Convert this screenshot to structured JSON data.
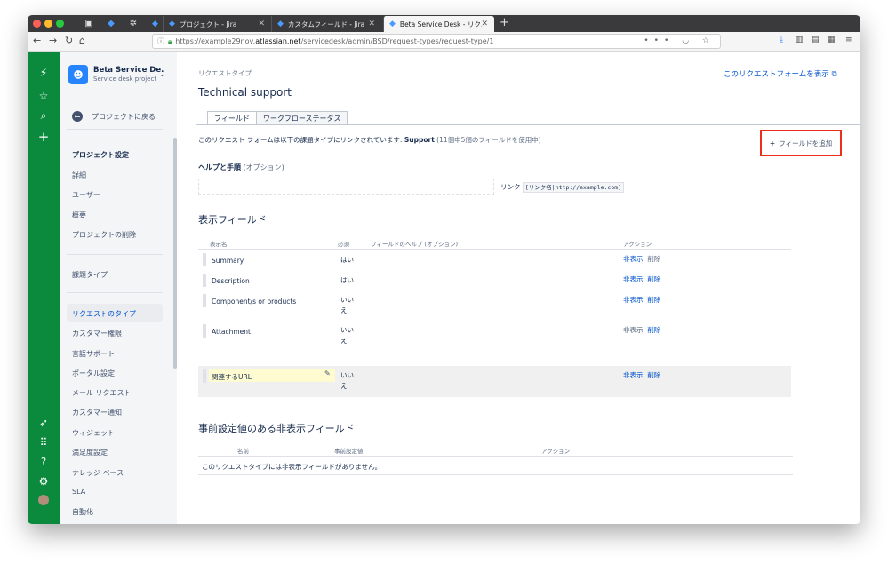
{
  "browser": {
    "tabs": [
      {
        "label": "",
        "icon": "app-icon"
      },
      {
        "label": "",
        "icon": "jira-icon"
      },
      {
        "label": "",
        "icon": "gear-icon"
      },
      {
        "label": "プロジェクト - Jira",
        "icon": "jira-icon"
      },
      {
        "label": "カスタムフィールド - Jira",
        "icon": "jira-icon"
      },
      {
        "label": "Beta Service Desk - リクエスト",
        "icon": "jira-icon"
      }
    ],
    "url_prefix": "https://example29nov.",
    "url_host": "atlassian.net",
    "url_path": "/servicedesk/admin/BSD/request-types/request-type/1"
  },
  "sidebar": {
    "project_name": "Beta Service De...",
    "project_type": "Service desk project",
    "back_label": "プロジェクトに戻る",
    "settings_heading": "プロジェクト設定",
    "items_a": [
      "詳細",
      "ユーザー",
      "概要",
      "プロジェクトの削除"
    ],
    "issue_types": "課題タイプ",
    "items_b": [
      "リクエストのタイプ",
      "カスタマー権限",
      "言語サポート",
      "ポータル設定",
      "メール リクエスト",
      "カスタマー通知",
      "ウィジェット",
      "満足度設定",
      "ナレッジ ベース",
      "SLA",
      "自動化"
    ]
  },
  "main": {
    "breadcrumb": "リクエストタイプ",
    "view_form_link": "このリクエストフォームを表示",
    "title": "Technical support",
    "tabs": [
      "フィールド",
      "ワークフローステータス"
    ],
    "link_desc_prefix": "このリクエスト フォームは以下の課題タイプにリンクされています:",
    "link_desc_type": "Support",
    "link_desc_suffix": "(11個中5個のフィールドを使用中)",
    "add_field": "フィールドを追加",
    "help_label": "ヘルプと手順",
    "help_optional": "(オプション)",
    "link_label": "リンク",
    "link_code": "[リンク名|http://example.com]",
    "visible_heading": "表示フィールド",
    "visible_columns": [
      "表示名",
      "必須",
      "フィールドのヘルプ (オプション)",
      "アクション"
    ],
    "fields": [
      {
        "name": "Summary",
        "required": "はい",
        "hide": "非表示",
        "delete": "削除"
      },
      {
        "name": "Description",
        "required": "はい",
        "hide": "非表示",
        "delete": "削除"
      },
      {
        "name": "Component/s or products",
        "required": "いいえ",
        "hide": "非表示",
        "delete": "削除"
      },
      {
        "name": "Attachment",
        "required": "いいえ",
        "hide": "非表示",
        "delete": "削除"
      },
      {
        "name": "関連するURL",
        "required": "いいえ",
        "hide": "非表示",
        "delete": "削除"
      }
    ],
    "hidden_heading": "事前設定値のある非表示フィールド",
    "hidden_columns": [
      "名前",
      "事前設定値",
      "アクション"
    ],
    "hidden_empty": "このリクエストタイプには非表示フィールドがありません。"
  }
}
